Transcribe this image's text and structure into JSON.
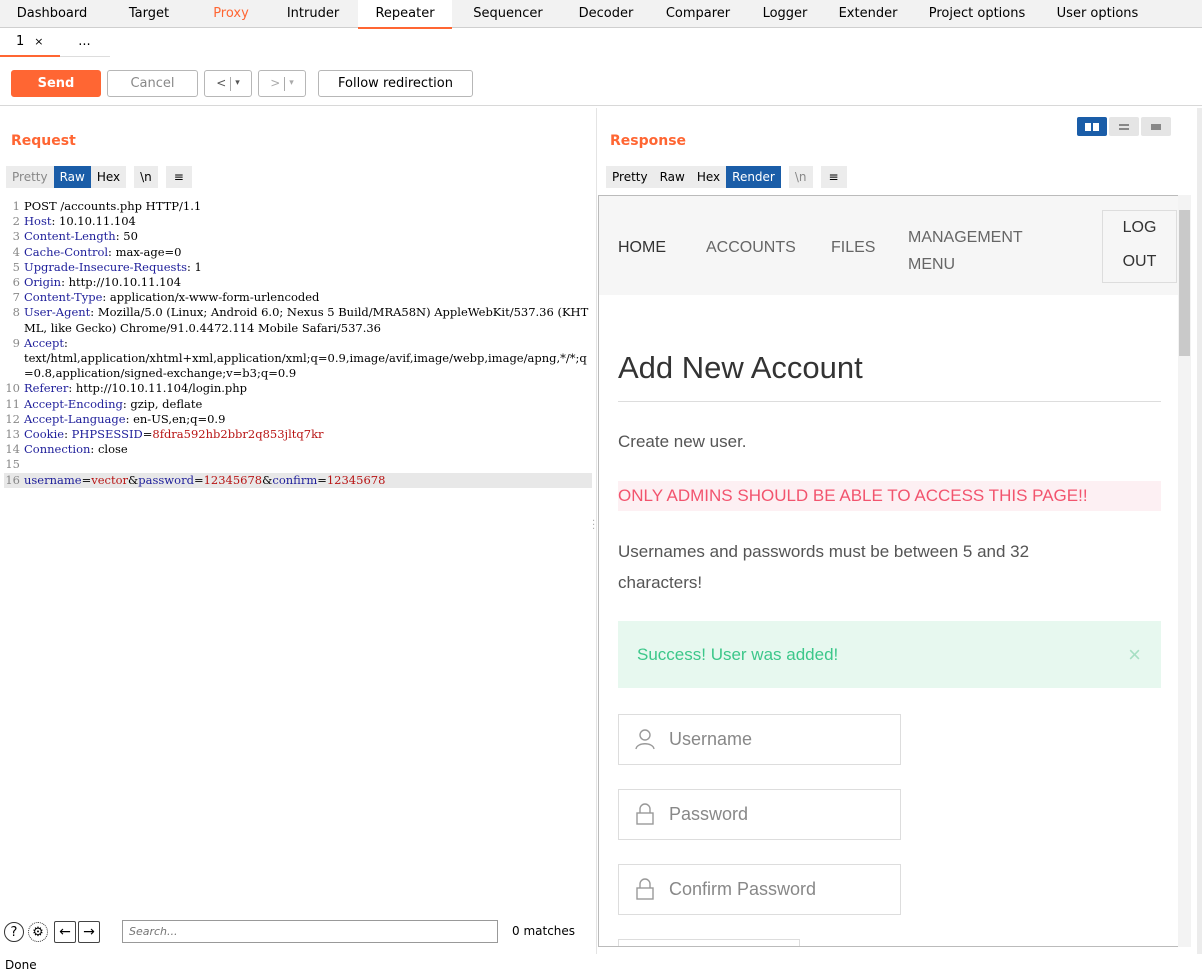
{
  "main_tabs": [
    {
      "label": "Dashboard",
      "w": 0
    },
    {
      "label": "Target"
    },
    {
      "label": "Proxy"
    },
    {
      "label": "Intruder"
    },
    {
      "label": "Repeater"
    },
    {
      "label": "Sequencer"
    },
    {
      "label": "Decoder"
    },
    {
      "label": "Comparer"
    },
    {
      "label": "Logger"
    },
    {
      "label": "Extender"
    },
    {
      "label": "Project options"
    },
    {
      "label": "User options"
    }
  ],
  "sub_tabs": {
    "tab1": "1",
    "close": "×",
    "more": "..."
  },
  "toolbar": {
    "send": "Send",
    "cancel": "Cancel",
    "back": "<",
    "forward": ">",
    "dropdown": "▾",
    "follow": "Follow redirection"
  },
  "request": {
    "title": "Request",
    "tabs": [
      "Pretty",
      "Raw",
      "Hex",
      "\\n",
      "≡"
    ],
    "active_tab": "Raw",
    "lines": [
      {
        "n": "1",
        "key": "",
        "val": "POST /accounts.php HTTP/1.1"
      },
      {
        "n": "2",
        "key": "Host",
        "val": " 10.10.11.104"
      },
      {
        "n": "3",
        "key": "Content-Length",
        "val": " 50"
      },
      {
        "n": "4",
        "key": "Cache-Control",
        "val": " max-age=0"
      },
      {
        "n": "5",
        "key": "Upgrade-Insecure-Requests",
        "val": " 1"
      },
      {
        "n": "6",
        "key": "Origin",
        "val": " http://10.10.11.104"
      },
      {
        "n": "7",
        "key": "Content-Type",
        "val": " application/x-www-form-urlencoded"
      },
      {
        "n": "8",
        "key": "User-Agent",
        "val": " Mozilla/5.0 (Linux; Android 6.0; Nexus 5 Build/MRA58N) AppleWebKit/537.36 (KHTML, like Gecko) Chrome/91.0.4472.114 Mobile Safari/537.36"
      },
      {
        "n": "9",
        "key": "Accept",
        "val": "\ntext/html,application/xhtml+xml,application/xml;q=0.9,image/avif,image/webp,image/apng,*/*;q=0.8,application/signed-exchange;v=b3;q=0.9"
      },
      {
        "n": "10",
        "key": "Referer",
        "val": " http://10.10.11.104/login.php"
      },
      {
        "n": "11",
        "key": "Accept-Encoding",
        "val": " gzip, deflate"
      },
      {
        "n": "12",
        "key": "Accept-Language",
        "val": " en-US,en;q=0.9"
      },
      {
        "n": "13",
        "key": "Cookie",
        "val": "",
        "cookie_name": " PHPSESSID",
        "cookie_val": "8fdra592hb2bbr2q853jltq7kr"
      },
      {
        "n": "14",
        "key": "Connection",
        "val": " close"
      },
      {
        "n": "15",
        "key": "",
        "val": ""
      }
    ],
    "body_line": {
      "n": "16",
      "p1k": "username",
      "p1v": "vector",
      "p2k": "password",
      "p2v": "12345678",
      "p3k": "confirm",
      "p3v": "12345678"
    }
  },
  "response": {
    "title": "Response",
    "tabs": [
      "Pretty",
      "Raw",
      "Hex",
      "Render",
      "\\n",
      "≡"
    ],
    "active_tab": "Render"
  },
  "render": {
    "nav": {
      "home": "HOME",
      "accounts": "ACCOUNTS",
      "files": "FILES",
      "management1": "MANAGEMENT",
      "management2": "MENU",
      "logout1": "LOG",
      "logout2": "OUT"
    },
    "heading": "Add New Account",
    "subtitle": "Create new user.",
    "warning": "ONLY ADMINS SHOULD BE ABLE TO ACCESS THIS PAGE!!",
    "rules1": "Usernames and passwords must be between 5 and 32",
    "rules2": "characters!",
    "success": "Success! User was added!",
    "close": "×",
    "username_ph": "Username",
    "password_ph": "Password",
    "confirm_ph": "Confirm Password"
  },
  "search": {
    "placeholder": "Search...",
    "matches": "0 matches"
  },
  "status": "Done",
  "colors": {
    "accent": "#ff6633",
    "active_tab": "#1a5da8",
    "success": "#3cc78a",
    "warning": "#f2546e"
  }
}
